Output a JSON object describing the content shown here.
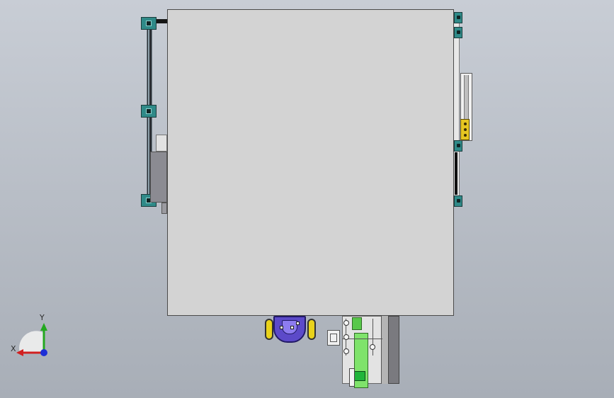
{
  "viewport": {
    "title": ""
  },
  "axis_triad": {
    "x_label": "X",
    "y_label": "Y",
    "colors": {
      "x_axis": "#d12020",
      "y_axis": "#23a81f",
      "z_axis": "#1d2fd6"
    }
  },
  "colors": {
    "background_top": "#c8cdd5",
    "background_bottom": "#a8aeb7",
    "enclosure": "#d3d3d3",
    "bracket_teal": "#2f8a88",
    "accent_yellow": "#e6c622",
    "gripper_blue": "#5c4ac9",
    "conveyor_green": "#7fe36b"
  },
  "icons": {
    "triad": "xyz-orientation-triad-icon"
  }
}
